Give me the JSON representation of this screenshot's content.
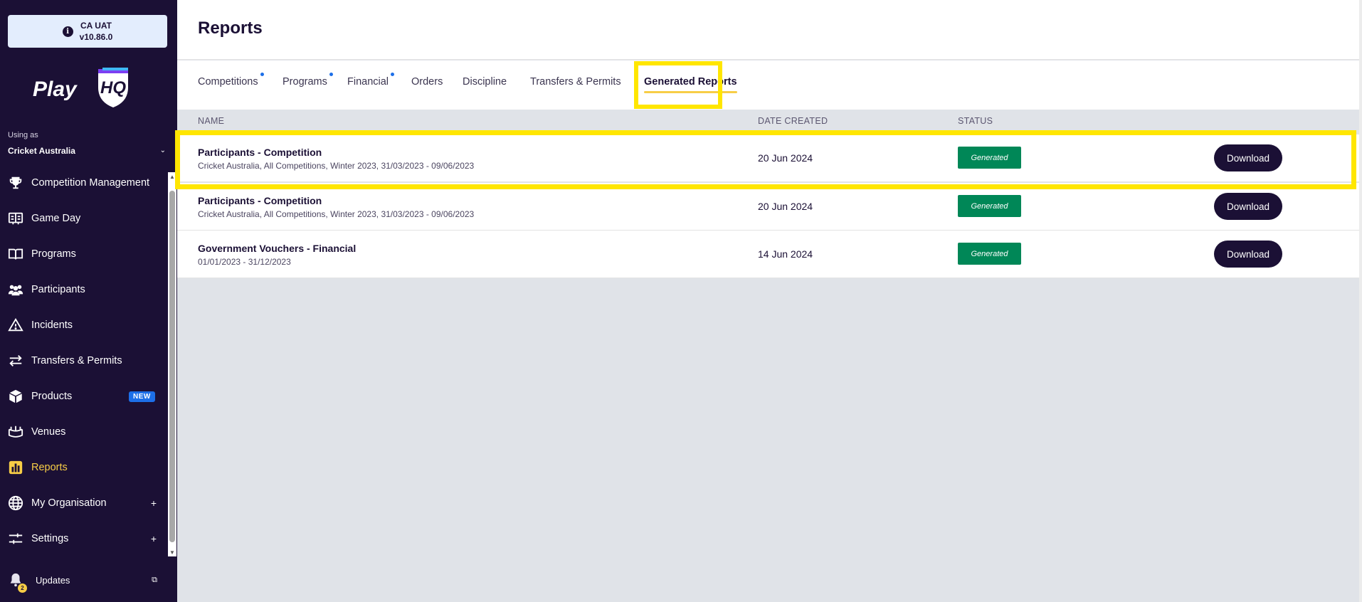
{
  "environment": {
    "name": "CA UAT",
    "version": "v10.86.0"
  },
  "logo": {
    "text": "PlayHQ"
  },
  "org": {
    "using_as_label": "Using as",
    "name": "Cricket Australia"
  },
  "nav": {
    "items": [
      {
        "label": "Competition Management",
        "icon": "trophy-icon"
      },
      {
        "label": "Game Day",
        "icon": "scoreboard-icon"
      },
      {
        "label": "Programs",
        "icon": "book-icon"
      },
      {
        "label": "Participants",
        "icon": "people-icon"
      },
      {
        "label": "Incidents",
        "icon": "warning-icon"
      },
      {
        "label": "Transfers & Permits",
        "icon": "transfer-arrows-icon"
      },
      {
        "label": "Products",
        "icon": "box-icon",
        "badge": "NEW"
      },
      {
        "label": "Venues",
        "icon": "stadium-icon"
      },
      {
        "label": "Reports",
        "icon": "reports-chart-icon",
        "active": true
      },
      {
        "label": "My Organisation",
        "icon": "globe-icon",
        "expand": "+"
      },
      {
        "label": "Settings",
        "icon": "sliders-icon",
        "expand": "+"
      }
    ],
    "updates_label": "Updates",
    "updates_count": "2"
  },
  "page": {
    "title": "Reports"
  },
  "tabs": [
    {
      "label": "Competitions",
      "dot": true
    },
    {
      "label": "Programs",
      "dot": true
    },
    {
      "label": "Financial",
      "dot": true
    },
    {
      "label": "Orders"
    },
    {
      "label": "Discipline"
    },
    {
      "label": "Transfers & Permits"
    },
    {
      "label": "Generated Reports",
      "active": true
    }
  ],
  "table": {
    "columns": {
      "name": "NAME",
      "date": "DATE CREATED",
      "status": "STATUS"
    },
    "rows": [
      {
        "name": "Participants - Competition",
        "details": "Cricket Australia, All Competitions, Winter 2023, 31/03/2023 - 09/06/2023",
        "date": "20 Jun 2024",
        "status": "Generated",
        "action": "Download"
      },
      {
        "name": "Participants - Competition",
        "details": "Cricket Australia, All Competitions, Winter 2023, 31/03/2023 - 09/06/2023",
        "date": "20 Jun 2024",
        "status": "Generated",
        "action": "Download"
      },
      {
        "name": "Government Vouchers - Financial",
        "details": "01/01/2023 - 31/12/2023",
        "date": "14 Jun 2024",
        "status": "Generated",
        "action": "Download"
      }
    ]
  },
  "colors": {
    "sidebar_bg": "#1b1035",
    "accent_yellow": "#f7cd46",
    "highlight": "#ffe600",
    "status_green": "#008757",
    "badge_blue": "#1d6fe8"
  }
}
